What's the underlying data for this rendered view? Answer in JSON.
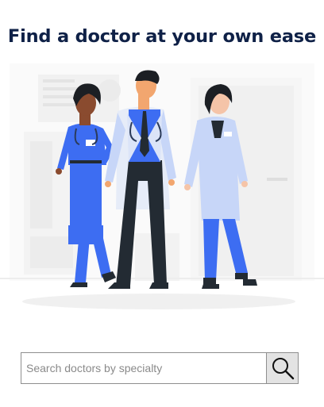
{
  "header": {
    "title": "Find a doctor at your own ease"
  },
  "hero": {
    "illustration": "three-doctors-illustration"
  },
  "search": {
    "placeholder": "Search doctors by specialty",
    "value": "",
    "button_icon": "search-icon"
  },
  "colors": {
    "title": "#0f2147",
    "scrub_blue": "#3d6df2",
    "coat": "#e6ecf8",
    "coat_light": "#c7d6f8",
    "dark": "#232b33"
  }
}
